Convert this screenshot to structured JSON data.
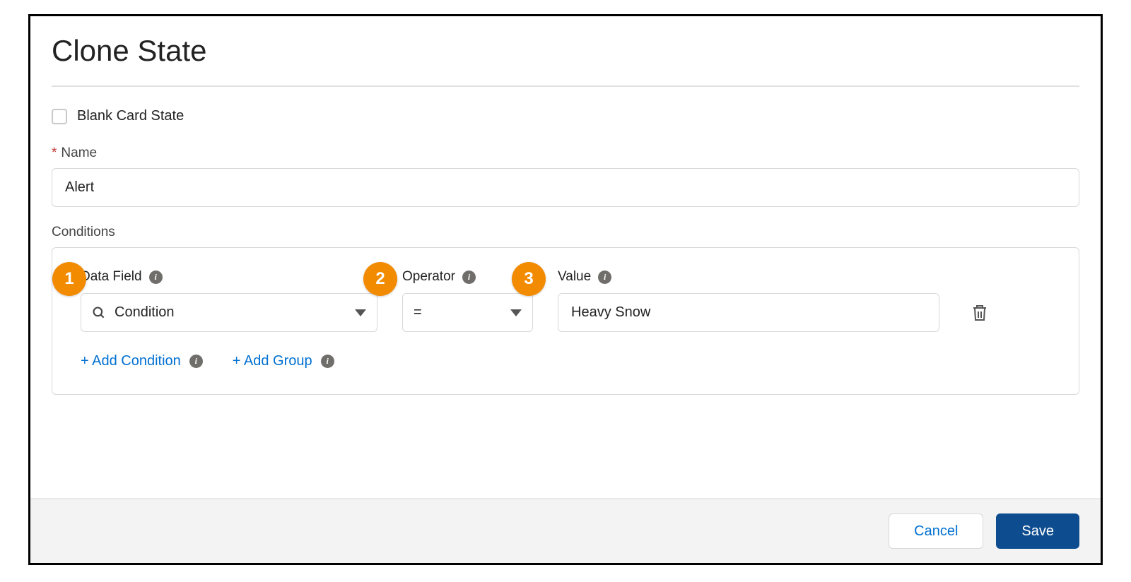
{
  "title": "Clone State",
  "blankState": {
    "label": "Blank Card State"
  },
  "nameField": {
    "label": "Name",
    "value": "Alert"
  },
  "conditions": {
    "label": "Conditions",
    "columns": {
      "dataField": {
        "label": "Data Field",
        "value": "Condition"
      },
      "operator": {
        "label": "Operator",
        "value": "="
      },
      "value": {
        "label": "Value",
        "value": "Heavy Snow"
      }
    },
    "actions": {
      "addCondition": "+ Add Condition",
      "addGroup": "+ Add Group"
    }
  },
  "callouts": {
    "c1": "1",
    "c2": "2",
    "c3": "3"
  },
  "footer": {
    "cancel": "Cancel",
    "save": "Save"
  }
}
